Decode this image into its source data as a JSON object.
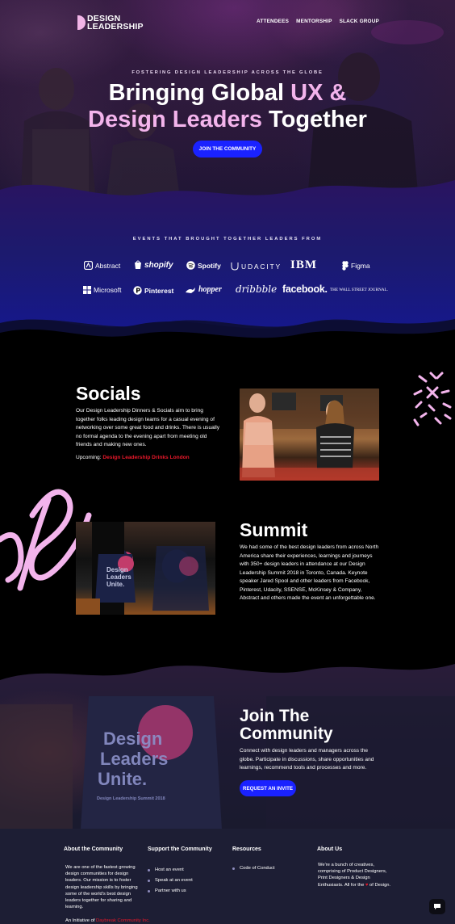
{
  "header": {
    "logo_line1": "DESIGN",
    "logo_line2": "LEADERSHIP",
    "nav": [
      "ATTENDEES",
      "MENTORSHIP",
      "SLACK GROUP"
    ]
  },
  "hero": {
    "eyebrow": "FOSTERING DESIGN LEADERSHIP ACROSS THE GLOBE",
    "title_part1": "Bringing Global ",
    "title_part2": "UX &",
    "title_part3": "Design Leaders",
    "title_part4": " Together",
    "cta": "JOIN THE COMMUNITY"
  },
  "events": {
    "title": "EVENTS THAT BROUGHT TOGETHER LEADERS FROM",
    "brands": [
      "Abstract",
      "shopify",
      "Spotify",
      "UDACITY",
      "IBM",
      "Figma",
      "Microsoft",
      "Pinterest",
      "hopper",
      "dribbble",
      "facebook.",
      "THE WALL STREET JOURNAL."
    ]
  },
  "socials": {
    "title": "Socials",
    "body": "Our Design Leadership Dinners & Socials aim to bring together folks leading design teams for a casual evening of networking over some great food and drinks. There is usually no formal agenda to the evening apart from meeting old friends and making new ones.",
    "upcoming_label": "Upcoming: ",
    "upcoming_link": "Design Leadership Drinks London"
  },
  "summit": {
    "title": "Summit",
    "body": "We had some of the best design leaders from across North America share their experiences, learnings and journeys with 350+ design leaders in attendance at our Design Leadership Summit 2018 in Toronto, Canada. Keynote speaker Jared Spool and other leaders from Facebook, Pinterest, Udacity, SSENSE, McKinsey & Company, Abstract and others made the event an unforgettable one.",
    "photo_text1": "Design",
    "photo_text2": "Leaders",
    "photo_text3": "Unite."
  },
  "join": {
    "title_line1": "Join The",
    "title_line2": "Community",
    "body": "Connect with design leaders and managers across the globe. Participate in discussions, share opportunities and learnings, recommend tools and processes and more.",
    "cta": "REQUEST AN INVITE",
    "bag_line1": "Design",
    "bag_line2": "Leaders",
    "bag_line3": "Unite.",
    "bag_caption": "Design Leadership Summit 2018"
  },
  "footer": {
    "about_head": "About the Community",
    "about_text": "We are one of the fastest growing design communities for design leaders. Our mission is to foster design leadership skills by bringing some of the world's best design leaders together for sharing and learning.",
    "support_head": "Support the Community",
    "support_links": [
      "Host an event",
      "Speak at an event",
      "Partner with us"
    ],
    "resources_head": "Resources",
    "resources_links": [
      "Code of Conduct"
    ],
    "aboutus_head": "About Us",
    "aboutus_text_1": "We're a bunch of creatives, comprising of Product Designers, Print Designers & Design Enthusiasts. All for the ",
    "aboutus_text_heart": "♥",
    "aboutus_text_2": " of Design.",
    "initiative_label": "An Initiative of ",
    "initiative_link": "Daybreak Community Inc."
  },
  "colors": {
    "accent_blue": "#1a22ff",
    "pink": "#f3b4ec",
    "link_red": "#e8182a",
    "footer_bg": "#1d1e34"
  }
}
